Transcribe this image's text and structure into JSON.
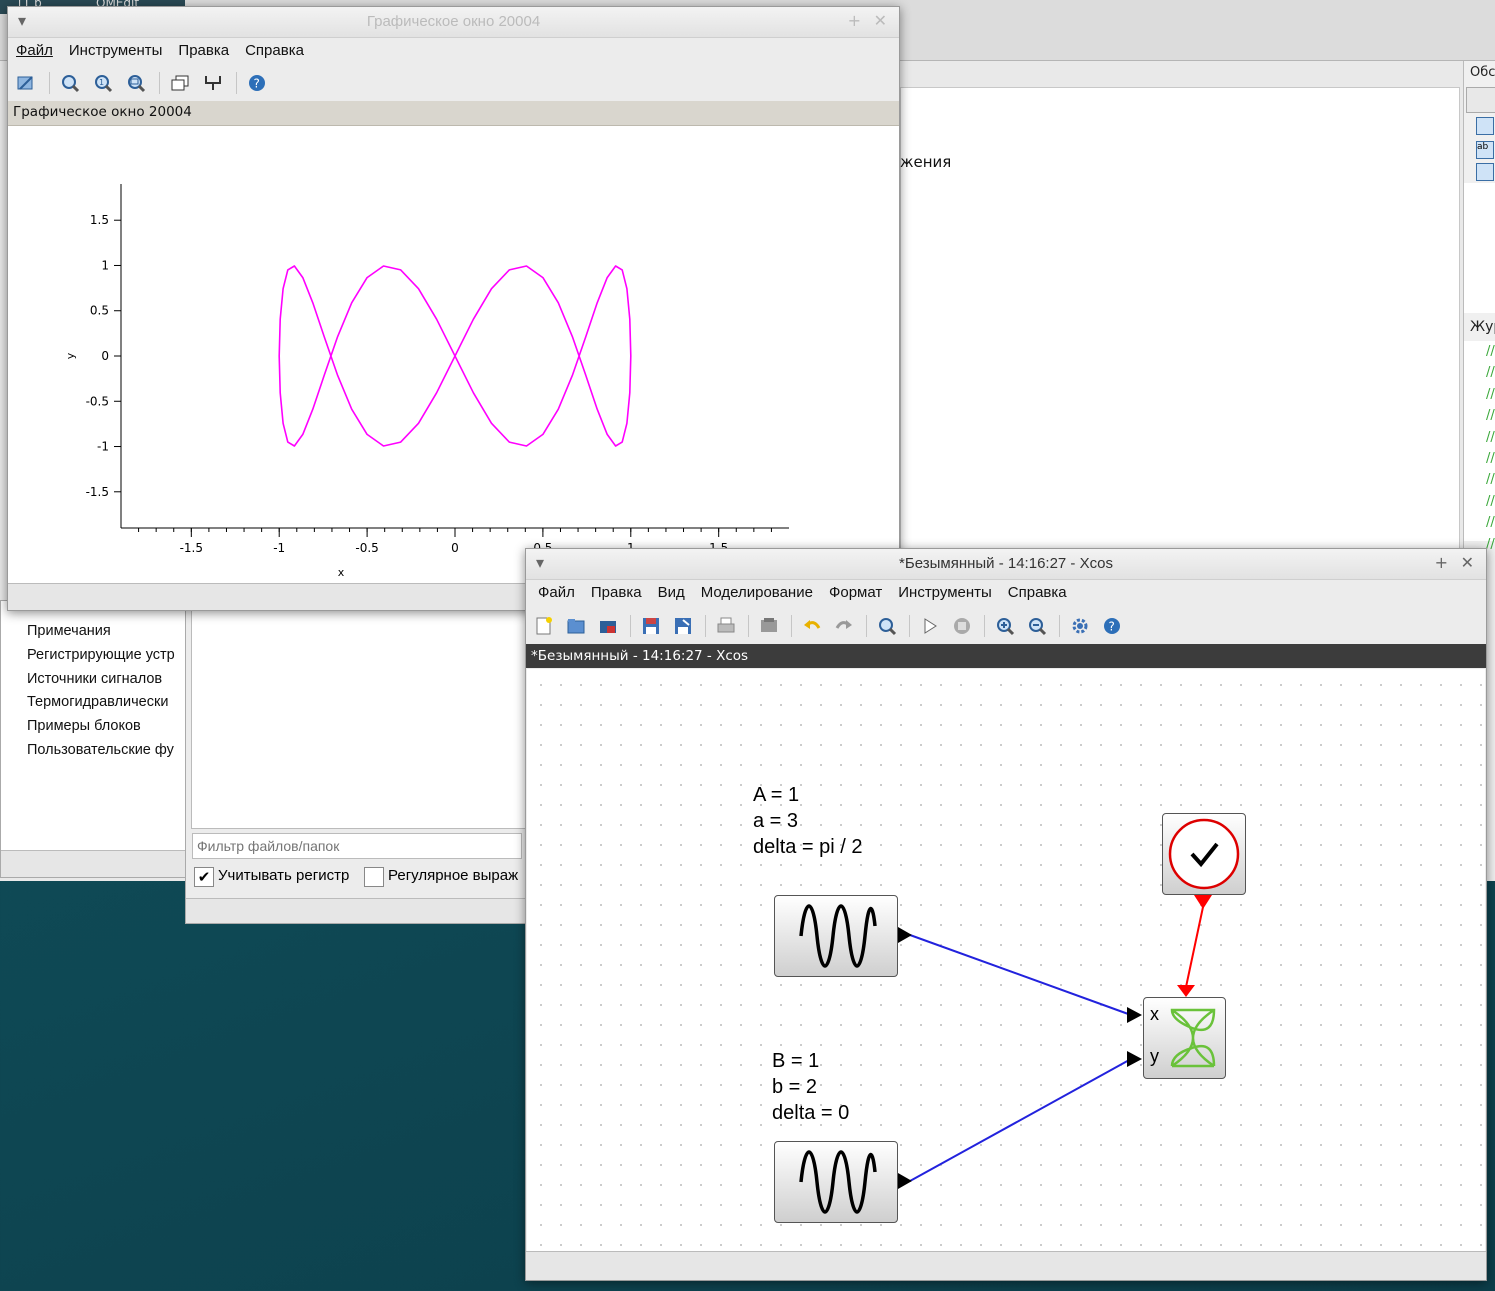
{
  "background_windows": {
    "top_left_fragment": "[1 b",
    "top_tab_fragment": "OMEdit",
    "console_fragment": "жения",
    "right_panel_title": "Обс",
    "right_panel_journal": "Жур"
  },
  "palette_browser": {
    "items": [
      "Примечания",
      "Регистрирующие устр",
      "Источники сигналов",
      "Термогидравлически",
      "Примеры блоков",
      "Пользовательские фу"
    ],
    "filter_placeholder": "Фильтр файлов/папок",
    "case_checkbox_label": "Учитывать регистр",
    "regex_checkbox_label": "Регулярное выраж"
  },
  "graphic_window": {
    "title": "Графическое окно 20004",
    "menu": [
      "Файл",
      "Инструменты",
      "Правка",
      "Справка"
    ],
    "subtitle": "Графическое окно 20004",
    "accent_color": "#ff00ff"
  },
  "chart_data": {
    "type": "line",
    "title": "",
    "xlabel": "x",
    "ylabel": "y",
    "xlim": [
      -1.9,
      1.9
    ],
    "ylim": [
      -1.9,
      1.9
    ],
    "x_ticks": [
      -1.5,
      -1,
      -0.5,
      0,
      0.5,
      1,
      1.5
    ],
    "x_tick_labels": [
      "-1.5",
      "-1",
      "-0.5",
      "0",
      "0.5",
      "1",
      "1.5"
    ],
    "y_ticks": [
      1.5,
      1,
      0.5,
      0,
      -0.5,
      -1,
      -1.5
    ],
    "y_tick_labels": [
      "1.5",
      "1",
      "0.5",
      "0",
      "-0.5",
      "-1",
      "-1.5"
    ],
    "grid": false,
    "series": [
      {
        "color": "#ff00ff",
        "x": [
          1.0,
          0.9945,
          0.9781,
          0.9511,
          0.9135,
          0.866,
          0.809,
          0.7431,
          0.6691,
          0.5878,
          0.5,
          0.4067,
          0.309,
          0.2079,
          0.1045,
          0.0,
          -0.1045,
          -0.2079,
          -0.309,
          -0.4067,
          -0.5,
          -0.5878,
          -0.6691,
          -0.7431,
          -0.809,
          -0.866,
          -0.9135,
          -0.9511,
          -0.9781,
          -0.9945,
          -1.0,
          -0.9945,
          -0.9781,
          -0.9511,
          -0.9135,
          -0.866,
          -0.809,
          -0.7431,
          -0.6691,
          -0.5878,
          -0.5,
          -0.4067,
          -0.309,
          -0.2079,
          -0.1045,
          0.0,
          0.1045,
          0.2079,
          0.309,
          0.4067,
          0.5,
          0.5878,
          0.6691,
          0.7431,
          0.809,
          0.866,
          0.9135,
          0.9511,
          0.9781,
          0.9945,
          1.0
        ],
        "y": [
          0.0,
          0.4067,
          0.7431,
          0.9511,
          0.9945,
          0.866,
          0.5878,
          0.2079,
          -0.2079,
          -0.5878,
          -0.866,
          -0.9945,
          -0.9511,
          -0.7431,
          -0.4067,
          0.0,
          0.4067,
          0.7431,
          0.9511,
          0.9945,
          0.866,
          0.5878,
          0.2079,
          -0.2079,
          -0.5878,
          -0.866,
          -0.9945,
          -0.9511,
          -0.7431,
          -0.4067,
          0.0,
          0.4067,
          0.7431,
          0.9511,
          0.9945,
          0.866,
          0.5878,
          0.2079,
          -0.2079,
          -0.5878,
          -0.866,
          -0.9945,
          -0.9511,
          -0.7431,
          -0.4067,
          0.0,
          0.4067,
          0.7431,
          0.9511,
          0.9945,
          0.866,
          0.5878,
          0.2079,
          -0.2079,
          -0.5878,
          -0.866,
          -0.9945,
          -0.9511,
          -0.7431,
          -0.4067,
          0.0
        ]
      }
    ]
  },
  "xcos_window": {
    "title": "*Безымянный - 14:16:27 - Xcos",
    "menu": [
      "Файл",
      "Правка",
      "Вид",
      "Моделирование",
      "Формат",
      "Инструменты",
      "Справка"
    ],
    "tab_title": "*Безымянный - 14:16:27 - Xcos",
    "note1": [
      "A = 1",
      "a = 3",
      "delta = pi / 2"
    ],
    "note2": [
      "B = 1",
      "b = 2",
      "delta = 0"
    ],
    "scope_port_x": "x",
    "scope_port_y": "y",
    "link_color": "#2222dd",
    "clock_link_color": "#ff0000"
  }
}
